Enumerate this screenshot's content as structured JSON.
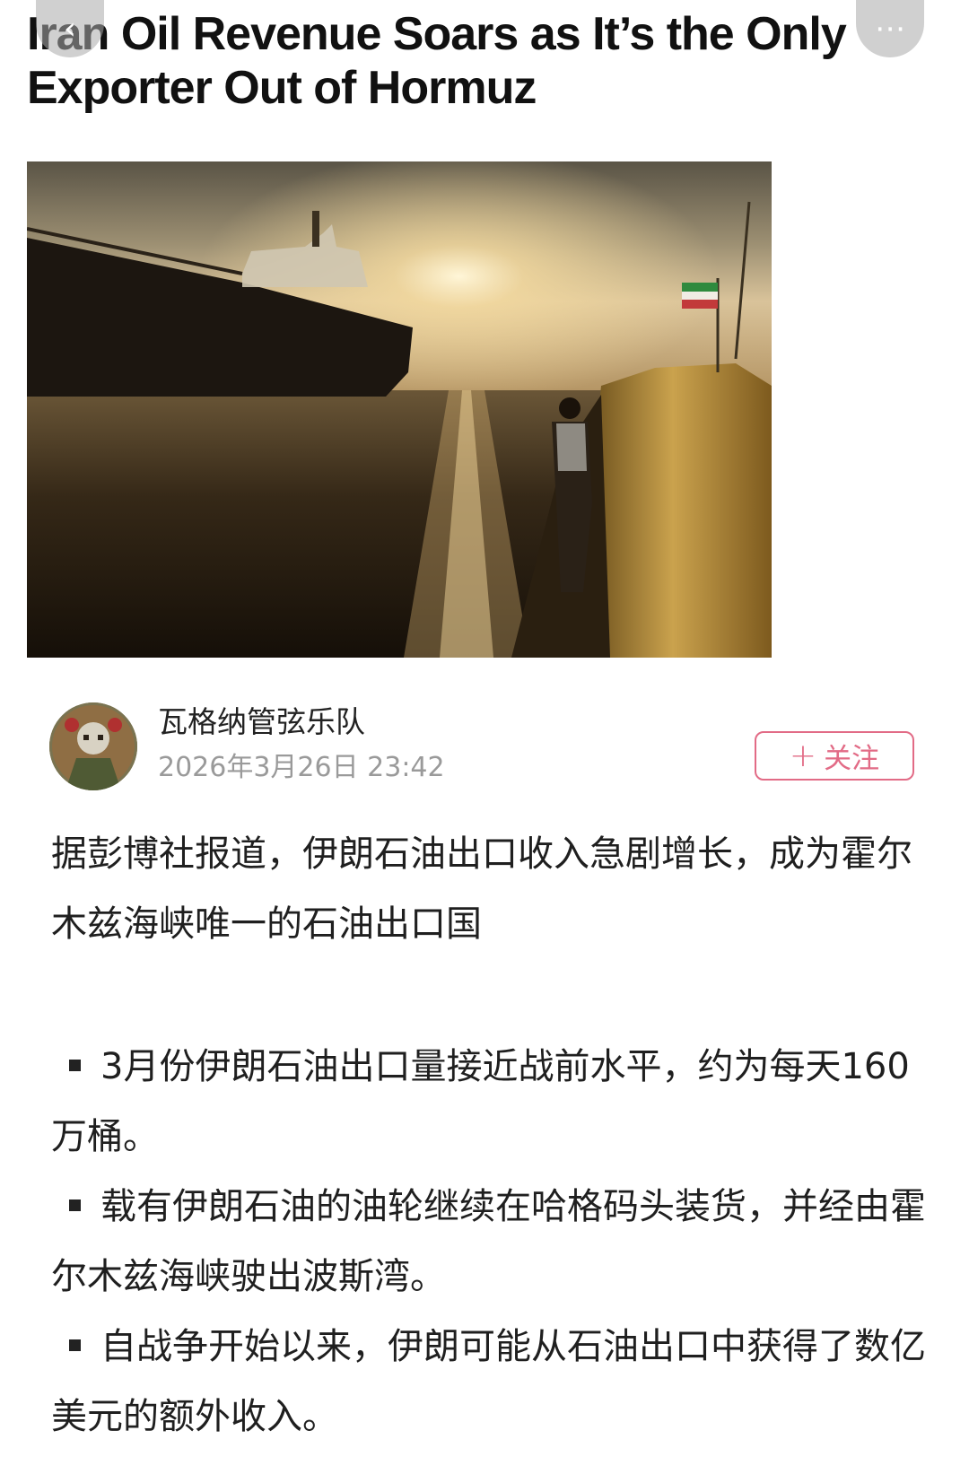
{
  "headline": {
    "line1": "Iran Oil Revenue Soars as It’s the Only",
    "line2": "Exporter Out of Hormuz"
  },
  "nav": {
    "back_icon": "‹",
    "more_icon": "⋯"
  },
  "author": {
    "name": "瓦格纳管弦乐队",
    "timestamp": "2026年3月26日 23:42"
  },
  "follow": {
    "plus": "+",
    "label": "关注",
    "color": "#e26b86"
  },
  "article": {
    "intro": "据彭博社报道，伊朗石油出口收入急剧增长，成为霍尔木兹海峡唯一的石油出口国",
    "bullets": [
      "3月份伊朗石油出口量接近战前水平，约为每天160万桶。",
      "载有伊朗石油的油轮继续在哈格码头装货，并经由霍尔木兹海峡驶出波斯湾。",
      "自战争开始以来，伊朗可能从石油出口中获得了数亿美元的额外收入。"
    ]
  }
}
